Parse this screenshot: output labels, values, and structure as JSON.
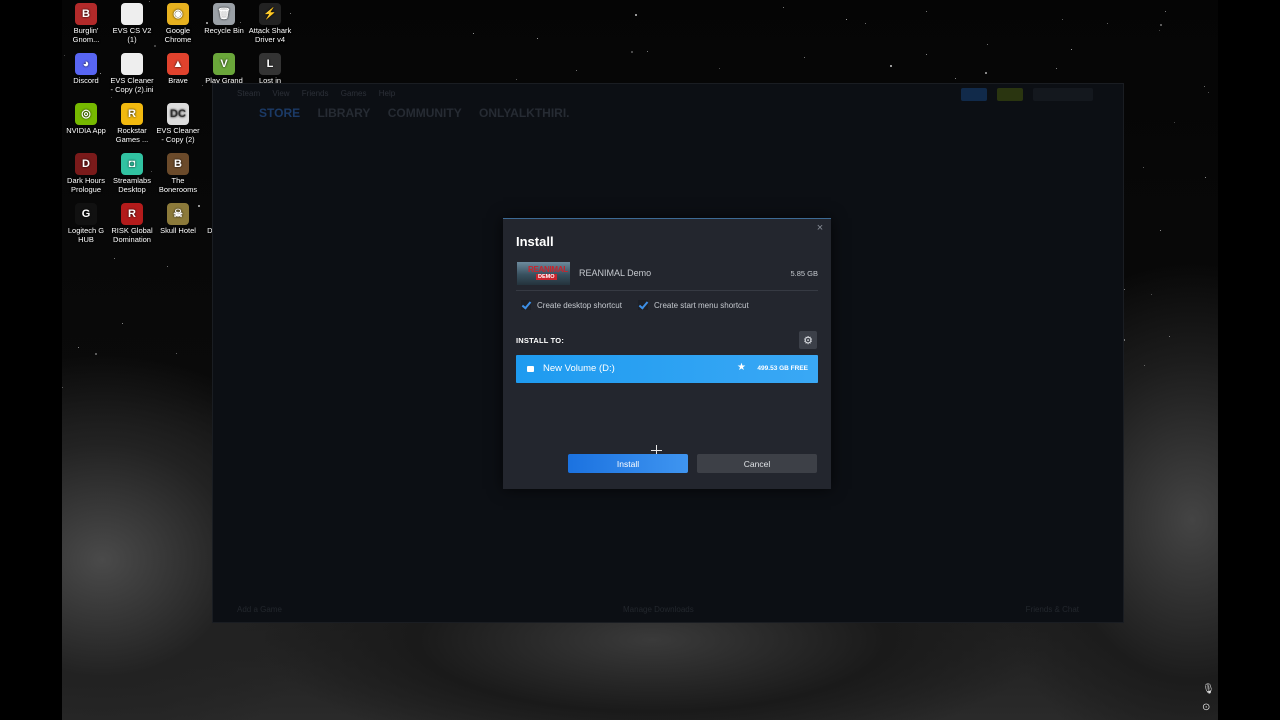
{
  "desktop": {
    "icons": [
      {
        "label": "Burglin' Gnom...",
        "icon": "burglin-gnomes-icon",
        "color": "#b22a2a",
        "glyph": "B"
      },
      {
        "label": "EVS CS V2 (1)",
        "icon": "file-icon",
        "color": "#eeeeee",
        "glyph": ""
      },
      {
        "label": "Google Chrome",
        "icon": "chrome-icon",
        "color": "#e7b11f",
        "glyph": "◉"
      },
      {
        "label": "Recycle Bin",
        "icon": "recycle-bin-icon",
        "color": "#9aa0a6",
        "glyph": "🗑"
      },
      {
        "label": "Attack Shark Driver v4",
        "icon": "attack-shark-icon",
        "color": "#222222",
        "glyph": "⚡"
      },
      {
        "label": "Discord",
        "icon": "discord-icon",
        "color": "#5865f2",
        "glyph": "◕"
      },
      {
        "label": "EVS Cleaner - Copy (2).ini",
        "icon": "ini-file-icon",
        "color": "#eeeeee",
        "glyph": ""
      },
      {
        "label": "Brave",
        "icon": "brave-icon",
        "color": "#e0422d",
        "glyph": "▲"
      },
      {
        "label": "Play Grand Th...",
        "icon": "gta-icon",
        "color": "#6aa63a",
        "glyph": "V"
      },
      {
        "label": "Lost in",
        "icon": "lost-in-icon",
        "color": "#333333",
        "glyph": "L"
      },
      {
        "label": "NVIDIA App",
        "icon": "nvidia-icon",
        "color": "#76b900",
        "glyph": "◎"
      },
      {
        "label": "Rockstar Games ...",
        "icon": "rockstar-icon",
        "color": "#f2b90f",
        "glyph": "R"
      },
      {
        "label": "EVS Cleaner - Copy (2)",
        "icon": "evs-cleaner-icon",
        "color": "#dcdcdc",
        "glyph": "DC"
      },
      {
        "label": "Dark Hours Prologue",
        "icon": "dark-hours-icon",
        "color": "#7a1a1a",
        "glyph": "D"
      },
      {
        "label": "Streamlabs Desktop",
        "icon": "streamlabs-icon",
        "color": "#31c3a2",
        "glyph": "◘"
      },
      {
        "label": "The Bonerooms",
        "icon": "bonerooms-icon",
        "color": "#6b4a2a",
        "glyph": "B"
      },
      {
        "label": "Logitech G HUB",
        "icon": "logitech-icon",
        "color": "#111111",
        "glyph": "G"
      },
      {
        "label": "RISK Global Domination",
        "icon": "risk-icon",
        "color": "#b31b1b",
        "glyph": "R"
      },
      {
        "label": "Skull Hotel",
        "icon": "skull-hotel-icon",
        "color": "#8c7a3a",
        "glyph": "☠"
      },
      {
        "label": "Dri... Ho...",
        "icon": "partial-icon",
        "color": "#333333",
        "glyph": ""
      }
    ]
  },
  "steam": {
    "menu": [
      "Steam",
      "View",
      "Friends",
      "Games",
      "Help"
    ],
    "nav": [
      "STORE",
      "LIBRARY",
      "COMMUNITY",
      "ONLYALKTHIRI."
    ],
    "footer": {
      "left": "Add a Game",
      "center": "Manage Downloads",
      "right": "Friends & Chat"
    }
  },
  "dialog": {
    "title": "Install",
    "close": "×",
    "game": {
      "name": "REANIMAL Demo",
      "size": "5.85 GB",
      "thumb_title": "REANIMAL",
      "thumb_badge": "DEMO"
    },
    "checkboxes": [
      {
        "label": "Create desktop shortcut",
        "checked": true
      },
      {
        "label": "Create start menu shortcut",
        "checked": true
      }
    ],
    "install_to_label": "INSTALL TO:",
    "settings_icon": "⚙",
    "volume": {
      "name": "New Volume (D:)",
      "free": "499.53 GB FREE",
      "star": "★"
    },
    "buttons": {
      "install": "Install",
      "cancel": "Cancel"
    }
  },
  "tray": {
    "mic": "🎙",
    "settings": "⊙"
  }
}
